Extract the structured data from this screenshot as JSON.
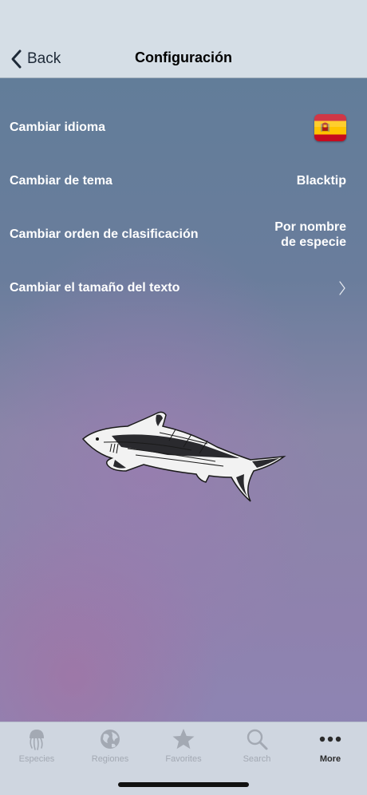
{
  "navbar": {
    "back_label": "Back",
    "title": "Configuración"
  },
  "settings": {
    "items": [
      {
        "label": "Cambiar idioma",
        "value": "",
        "icon": "spain-flag-icon"
      },
      {
        "label": "Cambiar de tema",
        "value": "Blacktip"
      },
      {
        "label": "Cambiar orden de clasificación",
        "value": "Por nombre de especie"
      },
      {
        "label": "Cambiar el tamaño del texto",
        "value": "",
        "icon": "chevron-right-icon"
      }
    ]
  },
  "tabbar": {
    "active_index": 4,
    "tabs": [
      {
        "label": "Especies",
        "icon": "jellyfish-icon"
      },
      {
        "label": "Regiones",
        "icon": "globe-icon"
      },
      {
        "label": "Favorites",
        "icon": "star-icon"
      },
      {
        "label": "Search",
        "icon": "search-icon"
      },
      {
        "label": "More",
        "icon": "more-icon"
      }
    ]
  },
  "colors": {
    "navbar_bg": "#d5dee6",
    "tabbar_bg": "#cfd6e0",
    "text_primary": "#ffffff",
    "tab_inactive": "#a3a9b3",
    "tab_active": "#2b2b2b"
  }
}
